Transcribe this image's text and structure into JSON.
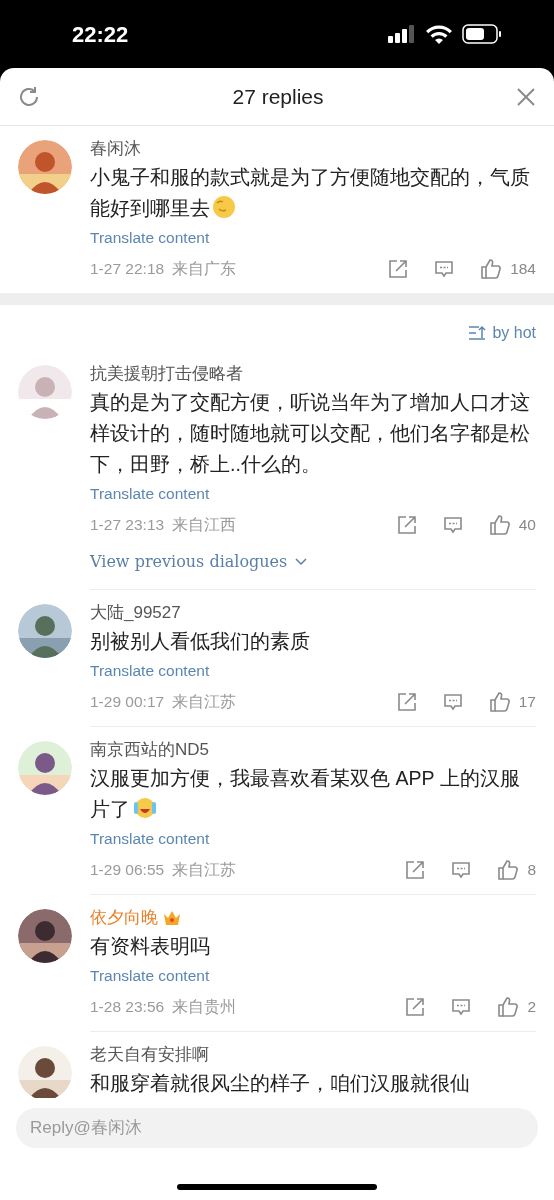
{
  "status_bar": {
    "time": "22:22"
  },
  "header": {
    "title": "27 replies"
  },
  "main_comment": {
    "name": "春闲沐",
    "vip": false,
    "text": "小鬼子和服的款式就是为了方便随地交配的，气质能好到哪里去",
    "emoji": {
      "kind": "smirk"
    },
    "translate": "Translate content",
    "time": "1-27 22:18",
    "location": "来自广东",
    "likes": "184"
  },
  "sort": {
    "label": "by hot"
  },
  "replies": [
    {
      "name": "抗美援朝打击侵略者",
      "vip": false,
      "text": "真的是为了交配方便，听说当年为了增加人口才这样设计的，随时随地就可以交配，他们名字都是松下，田野，桥上..什么的。",
      "translate": "Translate content",
      "time": "1-27 23:13",
      "location": "来自江西",
      "likes": "40",
      "more": "View previous dialogues"
    },
    {
      "name": "大陆_99527",
      "vip": false,
      "text": "别被别人看低我们的素质",
      "translate": "Translate content",
      "time": "1-29 00:17",
      "location": "来自江苏",
      "likes": "17"
    },
    {
      "name": "南京西站的ND5",
      "vip": false,
      "text": "汉服更加方便，我最喜欢看某双色 APP 上的汉服片了",
      "emoji": {
        "kind": "laugh-cry"
      },
      "translate": "Translate content",
      "time": "1-29 06:55",
      "location": "来自江苏",
      "likes": "8"
    },
    {
      "name": "依夕向晚",
      "vip": true,
      "text": "有资料表明吗",
      "translate": "Translate content",
      "time": "1-28 23:56",
      "location": "来自贵州",
      "likes": "2"
    },
    {
      "name": "老天自有安排啊",
      "vip": false,
      "text": "和服穿着就很风尘的样子，咱们汉服就很仙"
    }
  ],
  "reply_field": {
    "placeholder": "Reply@春闲沐"
  }
}
